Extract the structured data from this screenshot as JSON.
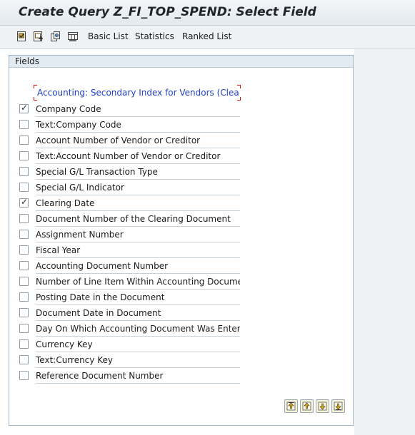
{
  "title": "Create Query Z_FI_TOP_SPEND: Select Field",
  "toolbar": {
    "icons": [
      "select-all-icon",
      "deselect-all-icon",
      "copy-icon",
      "layout-icon"
    ],
    "basic_list": "Basic List",
    "statistics": "Statistics",
    "ranked_list": "Ranked List"
  },
  "group": {
    "title": "Fields",
    "header": "Accounting: Secondary Index for Vendors (Cleared"
  },
  "fields": [
    {
      "label": "Company Code",
      "checked": true
    },
    {
      "label": "Text:Company Code",
      "checked": false
    },
    {
      "label": "Account Number of Vendor or Creditor",
      "checked": false
    },
    {
      "label": "Text:Account Number of Vendor or Creditor",
      "checked": false
    },
    {
      "label": "Special G/L Transaction Type",
      "checked": false
    },
    {
      "label": "Special G/L Indicator",
      "checked": false
    },
    {
      "label": "Clearing Date",
      "checked": true
    },
    {
      "label": "Document Number of the Clearing Document",
      "checked": false
    },
    {
      "label": "Assignment Number",
      "checked": false
    },
    {
      "label": "Fiscal Year",
      "checked": false
    },
    {
      "label": "Accounting Document Number",
      "checked": false
    },
    {
      "label": "Number of Line Item Within Accounting Document",
      "checked": false
    },
    {
      "label": "Posting Date in the Document",
      "checked": false
    },
    {
      "label": "Document Date in Document",
      "checked": false
    },
    {
      "label": "Day On Which Accounting Document Was Entered",
      "checked": false
    },
    {
      "label": "Currency Key",
      "checked": false
    },
    {
      "label": "Text:Currency Key",
      "checked": false
    },
    {
      "label": "Reference Document Number",
      "checked": false
    }
  ],
  "bottom_icons": [
    "page-first-icon",
    "page-up-icon",
    "page-down-icon",
    "page-last-icon"
  ],
  "check_mark": "✓"
}
